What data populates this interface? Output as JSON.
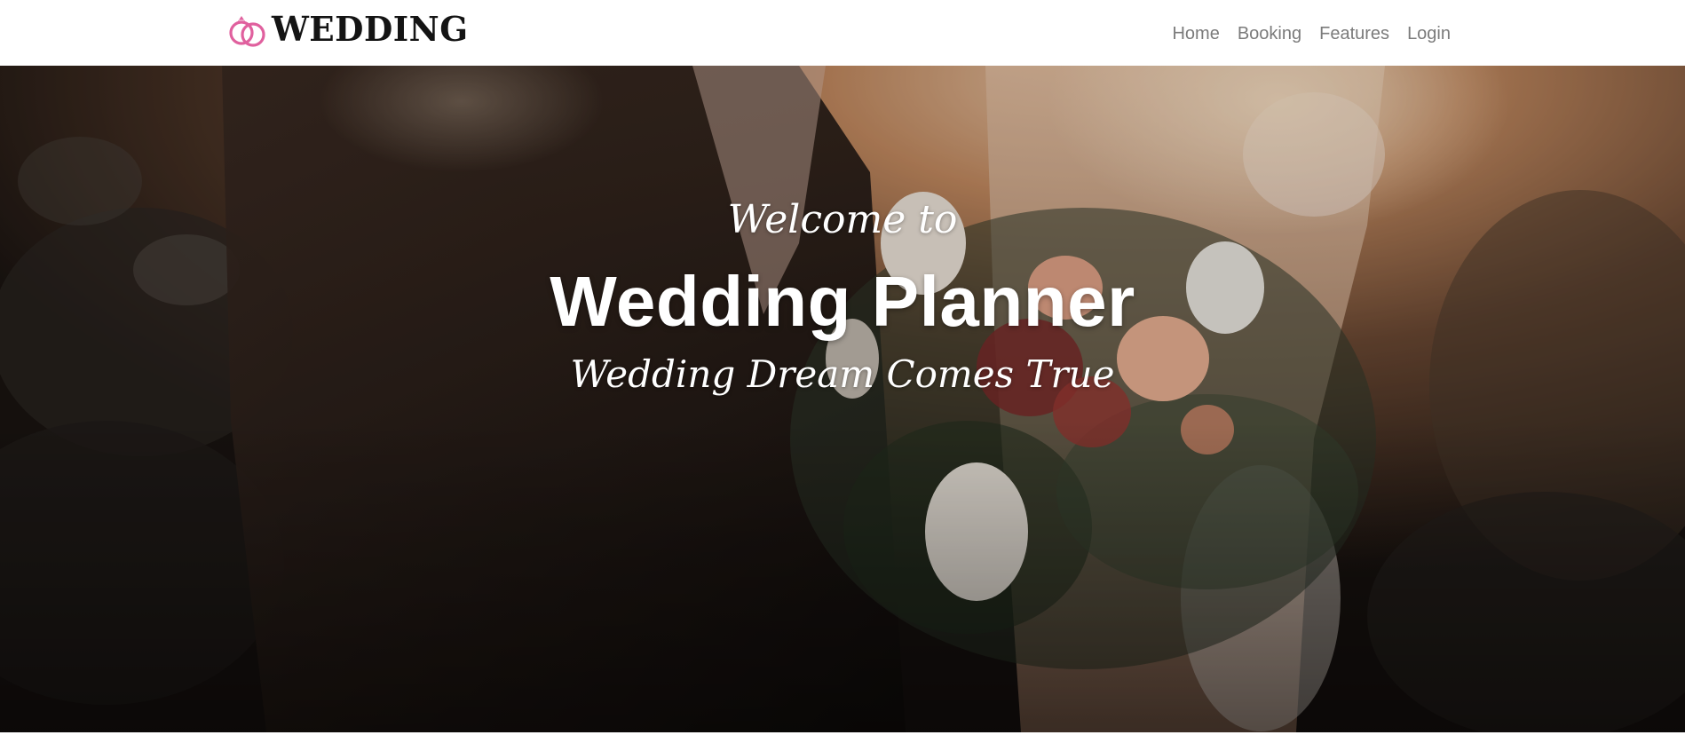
{
  "brand": {
    "name": "WEDDING",
    "icon": "wedding-rings-icon",
    "icon_color": "#e0609e"
  },
  "nav": {
    "items": [
      {
        "label": "Home"
      },
      {
        "label": "Booking"
      },
      {
        "label": "Features"
      },
      {
        "label": "Login"
      }
    ],
    "link_color": "#7b7b7b"
  },
  "hero": {
    "welcome": "Welcome to",
    "title": "Wedding Planner",
    "tagline": "Wedding Dream Comes True",
    "image": "wedding-couple-bouquet-photo"
  }
}
